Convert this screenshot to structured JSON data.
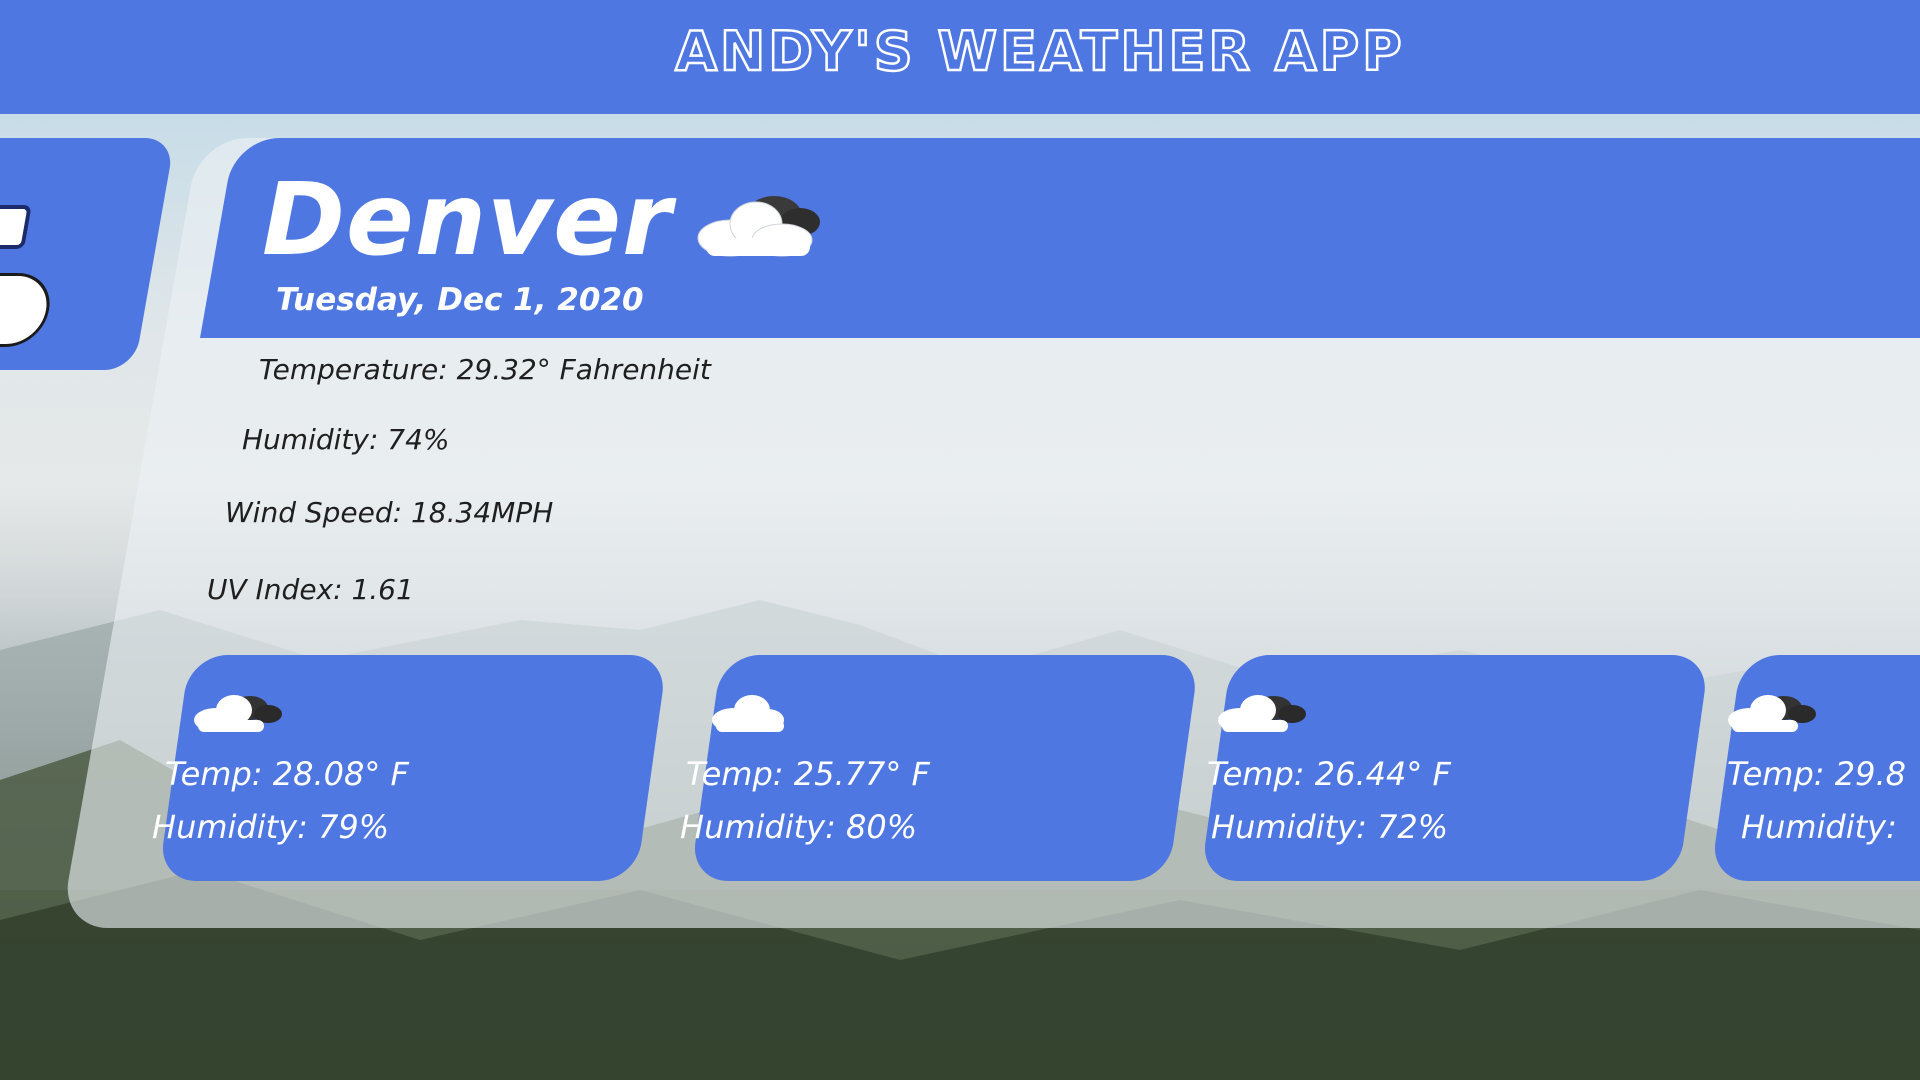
{
  "app": {
    "title": "ANDY'S WEATHER APP"
  },
  "search": {
    "search_icon": "search-icon"
  },
  "current": {
    "city": "Denver",
    "date": "Tuesday, Dec 1, 2020",
    "icon": "cloudy-icon",
    "temperature": "Temperature: 29.32° Fahrenheit",
    "humidity": "Humidity: 74%",
    "wind_speed": "Wind Speed: 18.34MPH",
    "uv_index": "UV Index: 1.61"
  },
  "forecast": [
    {
      "icon": "partly-cloudy-icon",
      "temp": "Temp: 28.08° F",
      "humidity": "Humidity: 79%"
    },
    {
      "icon": "cloud-icon",
      "temp": "Temp: 25.77° F",
      "humidity": "Humidity: 80%"
    },
    {
      "icon": "partly-cloudy-icon",
      "temp": "Temp: 26.44° F",
      "humidity": "Humidity: 72%"
    },
    {
      "icon": "partly-cloudy-icon",
      "temp": "Temp: 29.8",
      "humidity": "Humidity:"
    }
  ],
  "colors": {
    "accent": "#4f77e1",
    "panel": "#ecf0f3",
    "text_dark": "#1f1f1f",
    "text_light": "#ffffff"
  }
}
